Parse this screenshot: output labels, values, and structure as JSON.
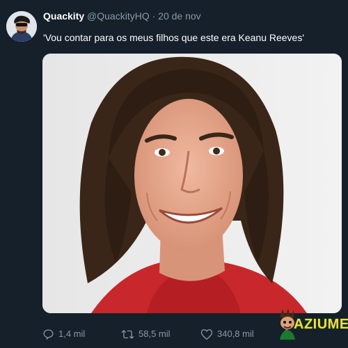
{
  "tweet": {
    "author_name": "Quackity",
    "handle": "@QuackityHQ",
    "separator": "·",
    "date": "20 de nov",
    "text": "'Vou contar para os meus filhos que este era Keanu Reeves'"
  },
  "actions": {
    "replies": "1,4 mil",
    "retweets": "58,5 mil",
    "likes": "340,8 mil"
  },
  "watermark": {
    "text": "AZIUME"
  },
  "colors": {
    "background": "#15202b",
    "secondary_text": "#8899a6",
    "watermark_text": "#ffd84a"
  },
  "icons": {
    "reply": "reply-icon",
    "retweet": "retweet-icon",
    "like": "heart-icon",
    "share": "share-icon"
  }
}
